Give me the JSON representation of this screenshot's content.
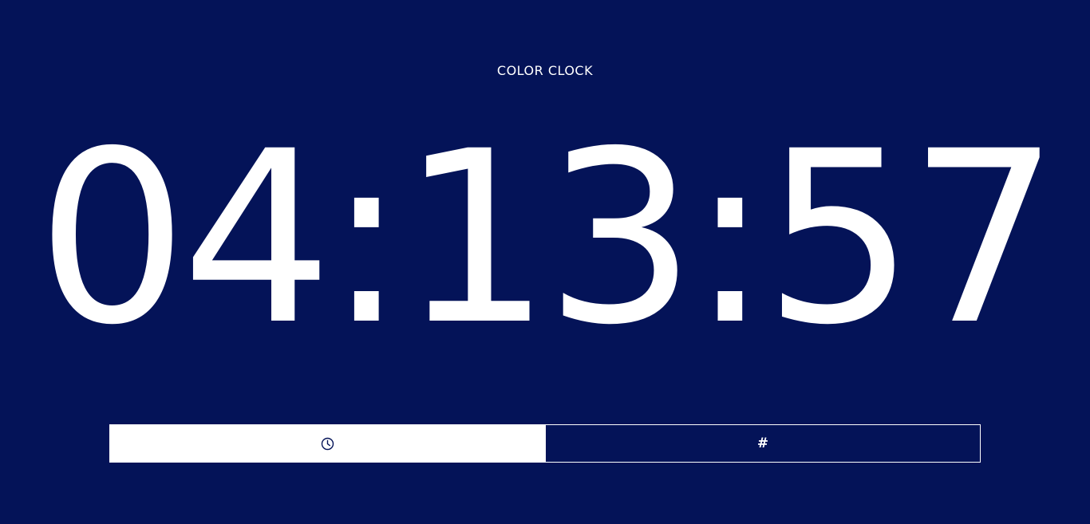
{
  "header": {
    "title": "COLOR CLOCK"
  },
  "clock": {
    "time": "04:13:57"
  },
  "toggle": {
    "options": [
      {
        "id": "time-mode",
        "icon": "clock-icon",
        "active": true
      },
      {
        "id": "hex-mode",
        "icon": "hash-icon",
        "label": "#",
        "active": false
      }
    ]
  },
  "colors": {
    "background": "#041358",
    "foreground": "#ffffff"
  }
}
